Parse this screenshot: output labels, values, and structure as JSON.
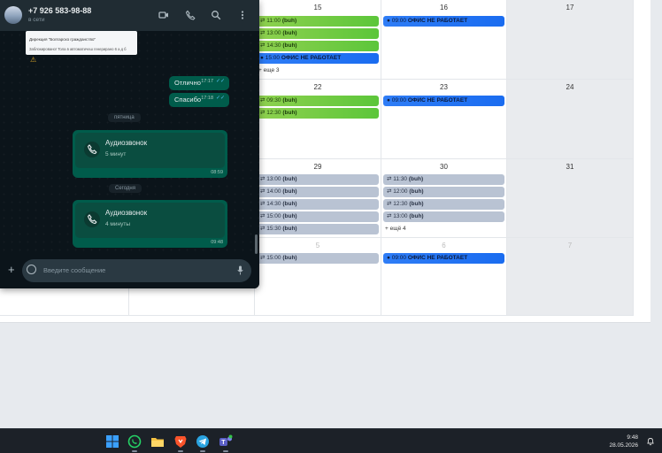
{
  "whatsapp": {
    "contact_name": "+7 926 583-98-88",
    "contact_status": "в сети",
    "preview_line1": "Дирекция \"Болгарско гражданство\"",
    "preview_line2": "Заблокировано! Тола в автоматичеш генерирано 6 а д б",
    "messages": [
      {
        "text": "Отлично",
        "time": "17:17"
      },
      {
        "text": "Спасибо",
        "time": "17:18"
      }
    ],
    "date_friday": "пятница",
    "date_today": "Сегодня",
    "calls": [
      {
        "title": "Аудиозвонок",
        "duration": "5 минут",
        "time": "08:59"
      },
      {
        "title": "Аудиозвонок",
        "duration": "4 минуты",
        "time": "09:48"
      }
    ],
    "input_placeholder": "Введите сообщение",
    "accent_color": "#005c4b"
  },
  "calendar": {
    "day_numbers": {
      "d15": "15",
      "d16": "16",
      "d17": "17",
      "d22": "22",
      "d23": "23",
      "d24": "24",
      "d29": "29",
      "d30": "30",
      "d31": "31",
      "d5": "5",
      "d6": "6",
      "d7": "7"
    },
    "events": {
      "e15_1": "11:00",
      "e15_2": "13:00",
      "e15_3": "14:30",
      "e15_4": "15:00",
      "e16_1": "09:00",
      "e22_1": "09:30",
      "e22_2": "12:30",
      "e23_1": "09:00",
      "e29_1": "13:00",
      "e29_2": "14:00",
      "e29_3": "14:30",
      "e29_4": "15:00",
      "e29_5": "15:30",
      "e30_1": "11:30",
      "e30_2": "12:00",
      "e30_3": "12:30",
      "e30_4": "13:00",
      "e5_1": "15:00",
      "e6_1": "09:00"
    },
    "tag_buh": "(buh)",
    "office_closed": "ОФИС НЕ РАБОТАЕТ",
    "more_15": "+ еще 3",
    "more_30": "+ ещё 4",
    "colors": {
      "green": "#6fcc43",
      "blue": "#1f72f3",
      "grey": "#b9c3d3"
    }
  },
  "taskbar": {
    "time": "9:48",
    "date": "28.05.2026",
    "apps": [
      "windows-start-icon",
      "whatsapp-icon",
      "file-explorer-icon",
      "brave-browser-icon",
      "telegram-icon",
      "teams-icon"
    ]
  }
}
